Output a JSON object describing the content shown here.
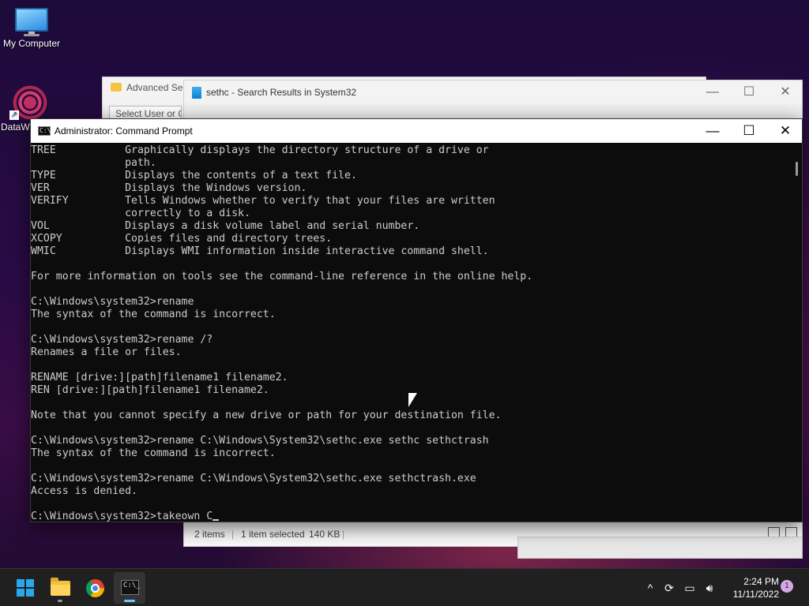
{
  "desktop": {
    "icons": [
      {
        "label": "My Computer"
      },
      {
        "label": "DataW"
      }
    ]
  },
  "background_windows": {
    "advanced_security": {
      "title": "Advanced Sec",
      "select_button": "Select User or Gr"
    },
    "explorer": {
      "title": "sethc - Search Results in System32",
      "status_items": "2 items",
      "status_selected": "1 item selected",
      "status_size": "140 KB"
    }
  },
  "cmd": {
    "title": "Administrator: Command Prompt",
    "icon_text": "C:\\_",
    "lines": [
      "TREE           Graphically displays the directory structure of a drive or",
      "               path.",
      "TYPE           Displays the contents of a text file.",
      "VER            Displays the Windows version.",
      "VERIFY         Tells Windows whether to verify that your files are written",
      "               correctly to a disk.",
      "VOL            Displays a disk volume label and serial number.",
      "XCOPY          Copies files and directory trees.",
      "WMIC           Displays WMI information inside interactive command shell.",
      "",
      "For more information on tools see the command-line reference in the online help.",
      "",
      "C:\\Windows\\system32>rename",
      "The syntax of the command is incorrect.",
      "",
      "C:\\Windows\\system32>rename /?",
      "Renames a file or files.",
      "",
      "RENAME [drive:][path]filename1 filename2.",
      "REN [drive:][path]filename1 filename2.",
      "",
      "Note that you cannot specify a new drive or path for your destination file.",
      "",
      "C:\\Windows\\system32>rename C:\\Windows\\System32\\sethc.exe sethc sethctrash",
      "The syntax of the command is incorrect.",
      "",
      "C:\\Windows\\system32>rename C:\\Windows\\System32\\sethc.exe sethctrash.exe",
      "Access is denied.",
      ""
    ],
    "prompt_line": "C:\\Windows\\system32>takeown C"
  },
  "window_controls": {
    "minimize": "—",
    "maximize": "☐",
    "close": "✕"
  },
  "taskbar": {
    "apps": [
      "start",
      "file-explorer",
      "chrome",
      "command-prompt"
    ],
    "tray_chevron": "^",
    "time": "2:24 PM",
    "date": "11/11/2022",
    "notification_count": "1"
  }
}
